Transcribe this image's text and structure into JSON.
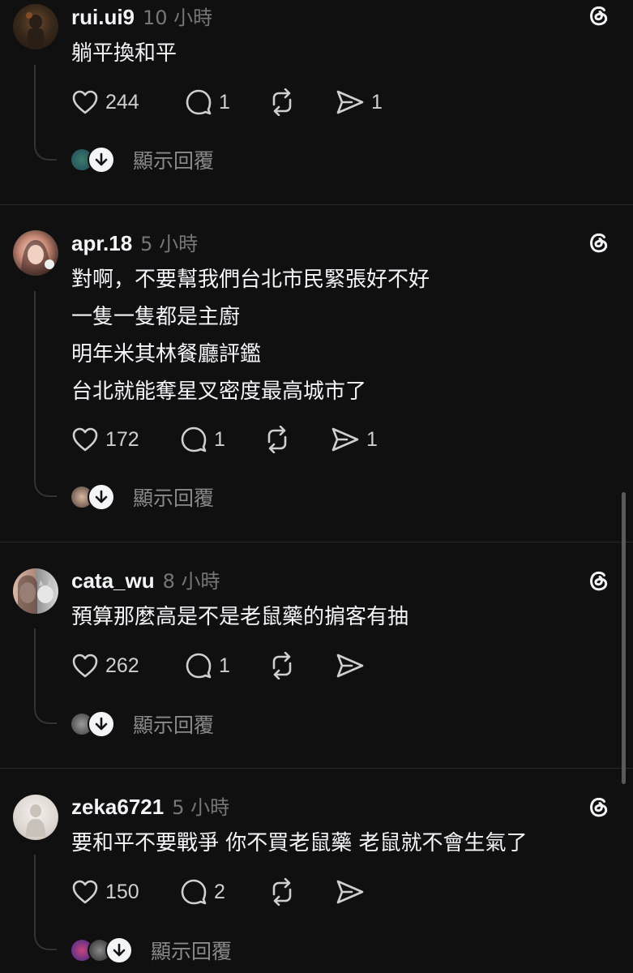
{
  "posts": [
    {
      "username": "rui.ui9",
      "time": "10 小時",
      "lines": [
        "躺平換和平"
      ],
      "likes": "244",
      "comments": "1",
      "reposts": "",
      "shares": "1",
      "show_replies": "顯示回覆"
    },
    {
      "username": "apr.18",
      "time": "5 小時",
      "lines": [
        "對啊，不要幫我們台北市民緊張好不好",
        "一隻一隻都是主廚",
        "明年米其林餐廳評鑑",
        "台北就能奪星叉密度最高城市了"
      ],
      "likes": "172",
      "comments": "1",
      "reposts": "",
      "shares": "1",
      "show_replies": "顯示回覆"
    },
    {
      "username": "cata_wu",
      "time": "8 小時",
      "lines": [
        "預算那麼高是不是老鼠藥的掮客有抽"
      ],
      "likes": "262",
      "comments": "1",
      "reposts": "",
      "shares": "",
      "show_replies": "顯示回覆"
    },
    {
      "username": "zeka6721",
      "time": "5 小時",
      "lines": [
        "要和平不要戰爭 你不買老鼠藥 老鼠就不會生氣了"
      ],
      "likes": "150",
      "comments": "2",
      "reposts": "",
      "shares": "",
      "show_replies": "顯示回覆"
    }
  ],
  "icons": {
    "like": "heart-icon",
    "comment": "comment-icon",
    "repost": "repost-icon",
    "share": "send-icon",
    "threads": "threads-logo-icon",
    "expand": "arrow-down-icon"
  },
  "colors": {
    "background": "#101010",
    "text": "#f3f5f7",
    "secondary": "#777777",
    "icon": "#cfcfcf"
  }
}
